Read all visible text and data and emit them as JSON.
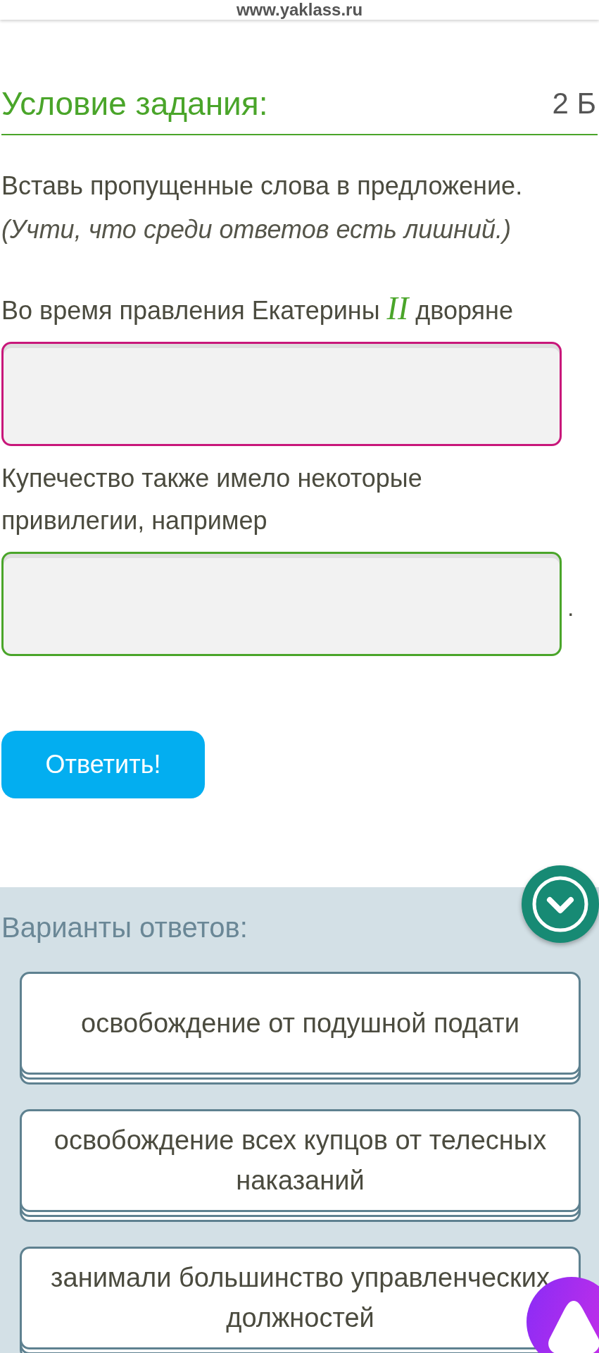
{
  "browser": {
    "url": "www.yaklass.ru"
  },
  "task": {
    "title": "Условие задания:",
    "points": "2 Б",
    "instruction": "Вставь пропущенные слова в предложение.",
    "note": "(Учти, что среди ответов есть лишний.)"
  },
  "passage": [
    {
      "kind": "sentence",
      "parts": [
        {
          "kind": "text",
          "text": "Во время правления Екатерины"
        },
        {
          "kind": "math",
          "text": "II"
        },
        {
          "kind": "text",
          "text": "дворяне"
        }
      ]
    },
    {
      "kind": "blank",
      "selected": true
    },
    {
      "kind": "sentence",
      "parts": [
        {
          "kind": "text",
          "text": "Купечество также имело некоторые привилегии, например"
        }
      ]
    },
    {
      "kind": "blank",
      "selected": false,
      "suffix": "."
    }
  ],
  "submit_button": {
    "label": "Ответить!"
  },
  "answers": {
    "title": "Варианты ответов:",
    "options": [
      "освобождение от подушной подати",
      "освобождение всех купцов от телесных наказаний",
      "занимали большинство управленческих должностей"
    ]
  }
}
